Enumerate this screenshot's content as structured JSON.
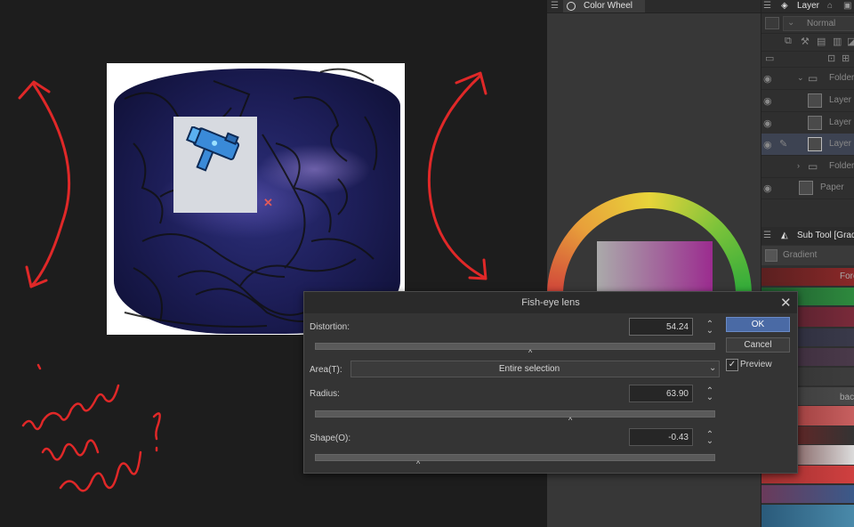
{
  "dialog": {
    "title": "Fish-eye lens",
    "close_icon": "close-icon",
    "distortion": {
      "label": "Distortion:",
      "value": "54.24",
      "slider_fraction": 0.54
    },
    "area": {
      "label": "Area(T):",
      "selected": "Entire selection"
    },
    "radius": {
      "label": "Radius:",
      "value": "63.90",
      "slider_fraction": 0.64
    },
    "shape": {
      "label": "Shape(O):",
      "value": "-0.43",
      "slider_fraction": 0.26
    },
    "ok_label": "OK",
    "cancel_label": "Cancel",
    "preview_label": "Preview",
    "preview_checked": true
  },
  "color_wheel_panel": {
    "tab_label": "Color Wheel"
  },
  "layer_panel": {
    "tab_label": "Layer",
    "blend_mode": "Normal",
    "layers": [
      {
        "label": "Folder"
      },
      {
        "label": "Layer"
      },
      {
        "label": "Layer"
      },
      {
        "label": "Layer"
      },
      {
        "label": "Folder"
      },
      {
        "label": "Paper"
      }
    ]
  },
  "subtool_panel": {
    "tab_label": "Sub Tool [Gradient",
    "group_label": "Gradient",
    "item_label_1": "Fore",
    "item_label_2": "bac"
  },
  "annotation": {
    "handwriting": "another way around ?"
  },
  "colors": {
    "accent": "#4a6aa5",
    "annotation_red": "#e02828"
  }
}
